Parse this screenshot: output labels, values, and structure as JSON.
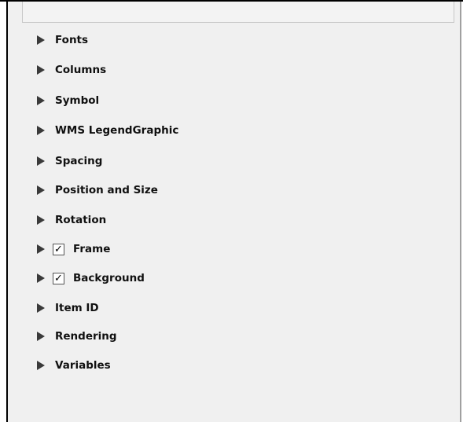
{
  "panel": {
    "groups": [
      {
        "label": "Fonts",
        "has_checkbox": false
      },
      {
        "label": "Columns",
        "has_checkbox": false
      },
      {
        "label": "Symbol",
        "has_checkbox": false
      },
      {
        "label": "WMS LegendGraphic",
        "has_checkbox": false
      },
      {
        "label": "Spacing",
        "has_checkbox": false
      },
      {
        "label": "Position and Size",
        "has_checkbox": false
      },
      {
        "label": "Rotation",
        "has_checkbox": false
      },
      {
        "label": "Frame",
        "has_checkbox": true,
        "checked": true
      },
      {
        "label": "Background",
        "has_checkbox": true,
        "checked": true
      },
      {
        "label": "Item ID",
        "has_checkbox": false
      },
      {
        "label": "Rendering",
        "has_checkbox": false
      },
      {
        "label": "Variables",
        "has_checkbox": false
      }
    ],
    "check_glyph": "✓"
  },
  "colors": {
    "panel_background": "#f0f0f0",
    "arrow": "#3a3a3a",
    "text": "#101010"
  },
  "icons": {
    "expand": "triangle-right-icon",
    "checkbox": "checkmark-icon"
  }
}
